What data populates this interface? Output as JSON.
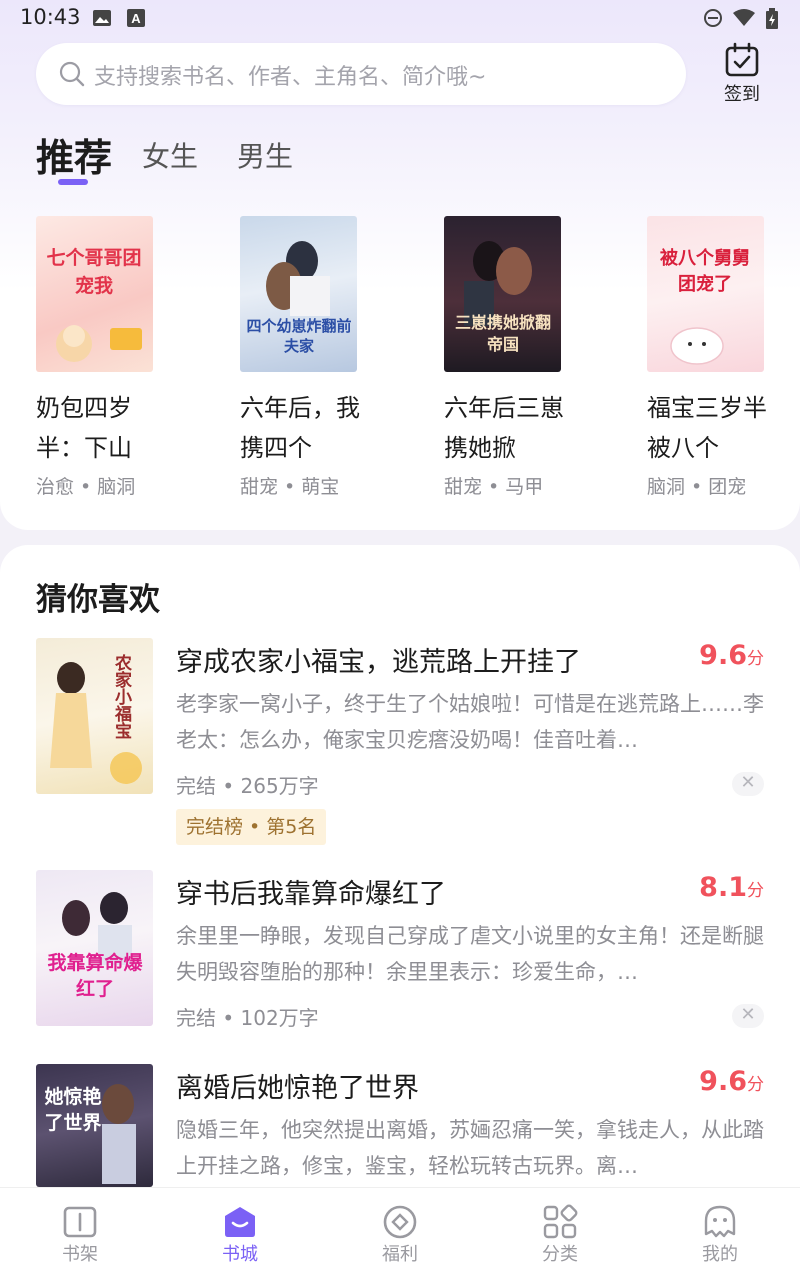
{
  "status_bar": {
    "time": "10:43"
  },
  "search": {
    "placeholder": "支持搜索书名、作者、主角名、简介哦~"
  },
  "checkin": {
    "label": "签到"
  },
  "tabs": [
    {
      "label": "推荐",
      "active": true
    },
    {
      "label": "女生",
      "active": false
    },
    {
      "label": "男生",
      "active": false
    }
  ],
  "featured": [
    {
      "title": "奶包四岁半：下山",
      "tags": "治愈 • 脑洞",
      "cover_text": "七个哥哥团宠我"
    },
    {
      "title": "六年后，我携四个",
      "tags": "甜宠 • 萌宝",
      "cover_text": "四个幼崽炸翻前夫家"
    },
    {
      "title": "六年后三崽携她掀",
      "tags": "甜宠 • 马甲",
      "cover_text": "三崽携她掀翻帝国"
    },
    {
      "title": "福宝三岁半被八个",
      "tags": "脑洞 • 团宠",
      "cover_text": "被八个舅舅团宠了"
    }
  ],
  "recommend": {
    "heading": "猜你喜欢",
    "books": [
      {
        "title": "穿成农家小福宝，逃荒路上开挂了",
        "score": "9.6",
        "score_unit": "分",
        "desc": "老李家一窝小子，终于生了个姑娘啦！可惜是在逃荒路上……李老太：怎么办，俺家宝贝疙瘩没奶喝！佳音吐着…",
        "meta": "完结 • 265万字",
        "badge": "完结榜 • 第5名",
        "cover_text": "农家小福宝"
      },
      {
        "title": "穿书后我靠算命爆红了",
        "score": "8.1",
        "score_unit": "分",
        "desc": "余里里一睁眼，发现自己穿成了虐文小说里的女主角！还是断腿失明毁容堕胎的那种！余里里表示：珍爱生命，…",
        "meta": "完结 • 102万字",
        "cover_text": "我靠算命爆红了"
      },
      {
        "title": "离婚后她惊艳了世界",
        "score": "9.6",
        "score_unit": "分",
        "desc": "隐婚三年，他突然提出离婚，苏婳忍痛一笑，拿钱走人，从此踏上开挂之路，修宝，鉴宝，轻松玩转古玩界。离…",
        "cover_text": "她惊艳了世界"
      }
    ]
  },
  "bottom_nav": [
    {
      "label": "书架",
      "icon": "bookshelf-icon",
      "active": false
    },
    {
      "label": "书城",
      "icon": "bookstore-icon",
      "active": true
    },
    {
      "label": "福利",
      "icon": "welfare-icon",
      "active": false
    },
    {
      "label": "分类",
      "icon": "category-icon",
      "active": false
    },
    {
      "label": "我的",
      "icon": "profile-icon",
      "active": false
    }
  ],
  "colors": {
    "accent": "#7b61f5",
    "score": "#f0525c",
    "badge_bg": "#fdf2dc"
  }
}
